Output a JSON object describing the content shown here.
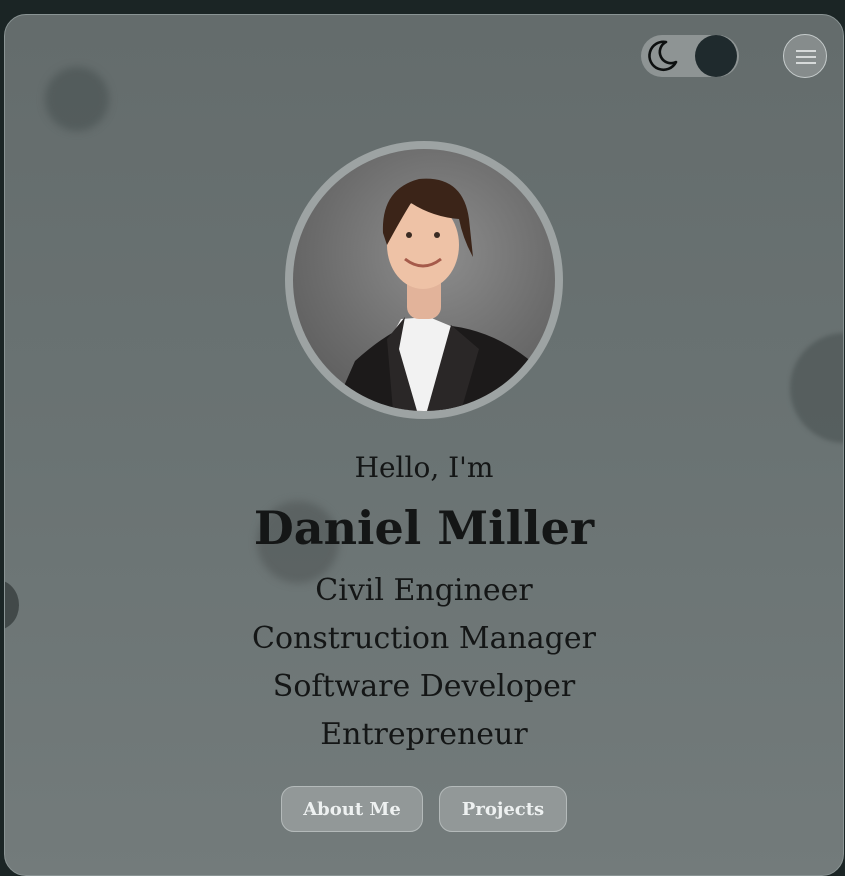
{
  "theme_toggle": {
    "icon": "moon-icon",
    "state": "dark"
  },
  "menu": {
    "icon": "hamburger-menu-icon"
  },
  "profile": {
    "photo": "profile-photo"
  },
  "hero": {
    "greeting": "Hello, I'm",
    "name": "Daniel Miller",
    "roles": [
      "Civil Engineer",
      "Construction Manager",
      "Software Developer",
      "Entrepreneur"
    ]
  },
  "actions": {
    "about_label": "About Me",
    "projects_label": "Projects"
  },
  "colors": {
    "card": "#6a7373",
    "knob": "#1f2a2d",
    "button": "#929898",
    "text": "#141616"
  }
}
